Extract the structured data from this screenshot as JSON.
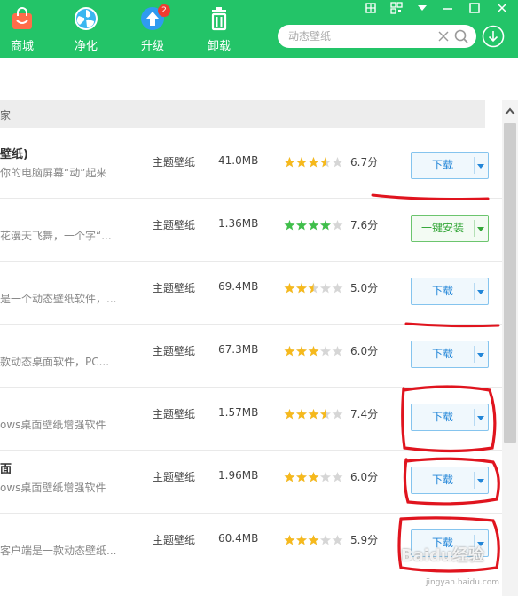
{
  "nav": {
    "items": [
      {
        "label": "商城",
        "icon": "bag-icon"
      },
      {
        "label": "净化",
        "icon": "fan-icon"
      },
      {
        "label": "升级",
        "icon": "upgrade-icon",
        "badge": "2"
      },
      {
        "label": "卸载",
        "icon": "trash-icon"
      }
    ]
  },
  "search": {
    "placeholder": "动态壁纸"
  },
  "section": {
    "title": "家"
  },
  "rows": [
    {
      "name": "壁纸)",
      "desc": "你的电脑屏幕“动”起来",
      "category": "主题壁纸",
      "size": "41.0MB",
      "rating": 3.5,
      "score": "6.7分",
      "button": "下载",
      "button_style": "blue"
    },
    {
      "name": "",
      "desc": "花漫天飞舞，一个字“...",
      "category": "主题壁纸",
      "size": "1.36MB",
      "rating": 4,
      "score": "7.6分",
      "button": "一键安装",
      "button_style": "green"
    },
    {
      "name": "",
      "desc": "是一个动态壁纸软件，...",
      "category": "主题壁纸",
      "size": "69.4MB",
      "rating": 2.5,
      "score": "5.0分",
      "button": "下载",
      "button_style": "blue"
    },
    {
      "name": "",
      "desc": "款动态桌面软件，PC...",
      "category": "主题壁纸",
      "size": "67.3MB",
      "rating": 3,
      "score": "6.0分",
      "button": "下载",
      "button_style": "blue"
    },
    {
      "name": "",
      "desc": "ows桌面壁纸增强软件",
      "category": "主题壁纸",
      "size": "1.57MB",
      "rating": 3.5,
      "score": "7.4分",
      "button": "下载",
      "button_style": "blue"
    },
    {
      "name": "面",
      "desc": "ows桌面壁纸增强软件",
      "category": "主题壁纸",
      "size": "1.96MB",
      "rating": 3,
      "score": "6.0分",
      "button": "下载",
      "button_style": "blue"
    },
    {
      "name": "",
      "desc": "客户端是一款动态壁纸...",
      "category": "主题壁纸",
      "size": "60.4MB",
      "rating": 3,
      "score": "5.9分",
      "button": "下载",
      "button_style": "blue"
    }
  ],
  "colors": {
    "accent": "#23c468",
    "star": "#f6b91c",
    "star_green": "#3fbf4a",
    "star_empty": "#d6d6d6",
    "annotation": "#e0141e"
  },
  "watermark": {
    "text": "Baidu经验",
    "sub": "jingyan.baidu.com"
  }
}
